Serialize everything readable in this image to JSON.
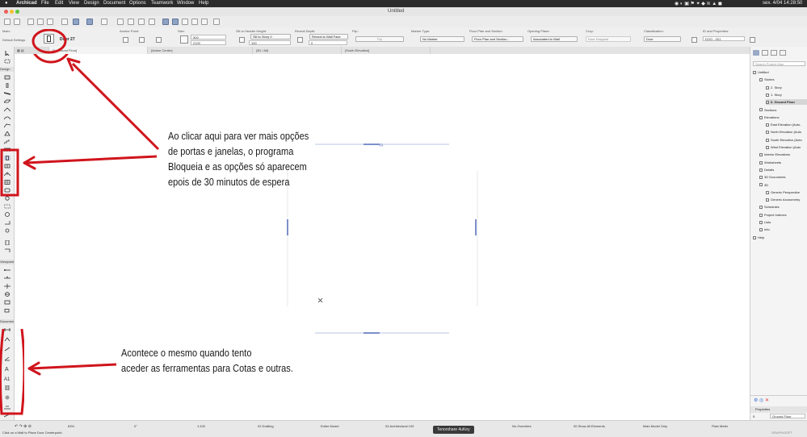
{
  "menubar": {
    "apple": "",
    "items": [
      "Archicad",
      "File",
      "Edit",
      "View",
      "Design",
      "Document",
      "Options",
      "Teamwork",
      "Window",
      "Help"
    ],
    "clock": "sex. 4/04  14:28:50"
  },
  "window": {
    "title": "Untitled"
  },
  "infobox": {
    "main_label": "Main:",
    "default_settings": "Default Settings",
    "element_name": "Door 27",
    "anchor_label": "Anchor Point:",
    "size_label": "Size:",
    "size_width": "900",
    "size_height": "2100",
    "sill_label": "Sill or Header Height:",
    "sill_ref": "Sill to Story 0",
    "sill_value": "100",
    "reveal_label": "Reveal Depth:",
    "reveal_ref": "Reveal to Wall Face",
    "reveal_value": "0",
    "flip_label": "Flip:",
    "flip_value": "Flip",
    "marker_label": "Marker Type:",
    "marker_value": "No Marker",
    "floorplan_label": "Floor Plan and Section:",
    "floorplan_value": "Floor Plan and Section...",
    "opening_label": "Opening Plane:",
    "opening_value": "Associated to Wall",
    "crop_label": "Crop:",
    "crop_value": "Door Dropped",
    "class_label": "Classification:",
    "class_value": "Door",
    "id_label": "ID and Properties:",
    "id_value": "DOO - 001"
  },
  "tabs": [
    "[0. Ground Floor]",
    "[Action Center]",
    "[3D / All]",
    "[South Elevation]"
  ],
  "toolbox": {
    "categories": [
      "Design",
      "Viewpoint",
      "Document"
    ]
  },
  "navigator": {
    "search_placeholder": "Search Project Map",
    "items": [
      {
        "label": "Untitled",
        "indent": 0
      },
      {
        "label": "Stories",
        "indent": 1
      },
      {
        "label": "2. Story",
        "indent": 2
      },
      {
        "label": "1. Story",
        "indent": 2
      },
      {
        "label": "0. Ground Floor",
        "indent": 2,
        "selected": true
      },
      {
        "label": "Sections",
        "indent": 1
      },
      {
        "label": "Elevations",
        "indent": 1
      },
      {
        "label": "East Elevation (Auto-",
        "indent": 2
      },
      {
        "label": "North Elevation (Auto",
        "indent": 2
      },
      {
        "label": "South Elevation (Auto",
        "indent": 2
      },
      {
        "label": "West Elevation (Auto",
        "indent": 2
      },
      {
        "label": "Interior Elevations",
        "indent": 1
      },
      {
        "label": "Worksheets",
        "indent": 1
      },
      {
        "label": "Details",
        "indent": 1
      },
      {
        "label": "3D Documents",
        "indent": 1
      },
      {
        "label": "3D",
        "indent": 1
      },
      {
        "label": "Generic Perspective",
        "indent": 2
      },
      {
        "label": "Generic Axonometry",
        "indent": 2
      },
      {
        "label": "Schedules",
        "indent": 1
      },
      {
        "label": "Project Indexes",
        "indent": 1
      },
      {
        "label": "Lists",
        "indent": 1
      },
      {
        "label": "Info",
        "indent": 1
      },
      {
        "label": "Help",
        "indent": 0
      }
    ],
    "properties_title": "Properties",
    "prop_story": "0.",
    "prop_story_name": "Ground Floor",
    "settings_button": "Settings..."
  },
  "statusbar": {
    "zoom": "63%",
    "angle": "0°",
    "scale": "1:100",
    "layer": "02 Drafting",
    "model": "Entire Model",
    "pen": "03 Architectural 100",
    "override": "No Overrides",
    "renovation": "00 Show All Elements",
    "mvo": "Main Model Only",
    "struct": "Plain Meter",
    "hint": "Click on a Wall to Place Door Centerpoint.",
    "brand": "GRAPHISOFT"
  },
  "tooltip": "Tenorshare 4uKey",
  "annotations": {
    "top_lines": [
      "Ao clicar aqui para ver mais opções",
      "de portas e janelas, o programa",
      "Bloqueia e as opções só aparecem",
      "epois de 30 minutos de espera"
    ],
    "bottom_lines": [
      "Acontece o mesmo quando tento",
      "aceder  as ferramentas para Cotas e outras."
    ]
  },
  "colors": {
    "annotation_red": "#d0141c",
    "selection_blue": "#8fa3c5"
  }
}
